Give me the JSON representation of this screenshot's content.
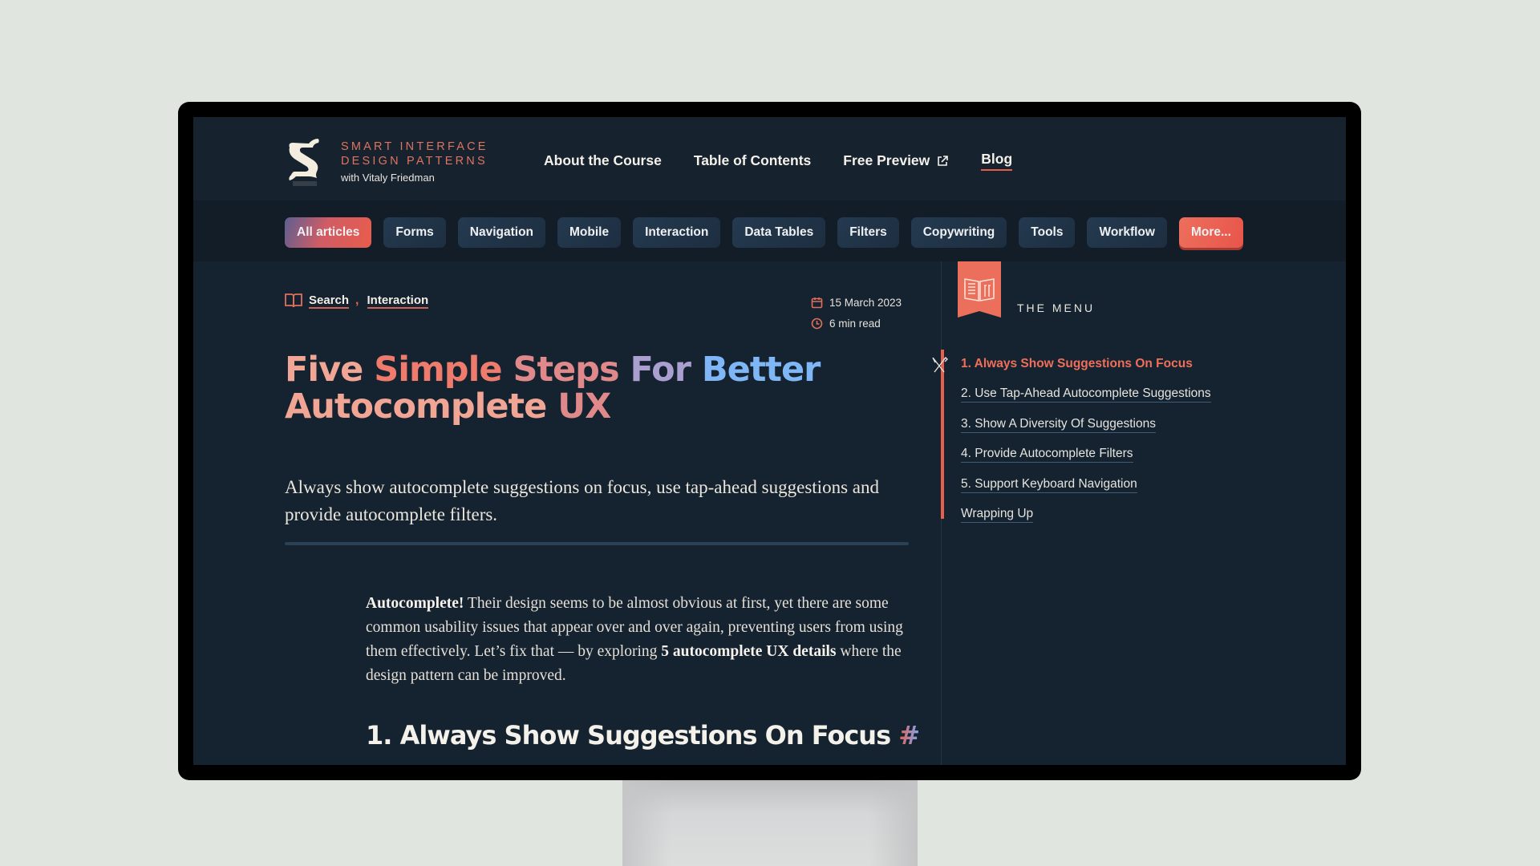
{
  "site": {
    "logo_line1": "SMART INTERFACE",
    "logo_line2": "DESIGN PATTERNS",
    "logo_sub": "with Vitaly Friedman",
    "logo_icon": "s-monogram-icon"
  },
  "nav": {
    "items": [
      {
        "label": "About the Course",
        "active": false
      },
      {
        "label": "Table of Contents",
        "active": false
      },
      {
        "label": "Free Preview",
        "active": false,
        "icon": "external-link-icon"
      },
      {
        "label": "Blog",
        "active": true
      }
    ]
  },
  "filters": {
    "items": [
      {
        "label": "All articles",
        "active": true
      },
      {
        "label": "Forms"
      },
      {
        "label": "Navigation"
      },
      {
        "label": "Mobile"
      },
      {
        "label": "Interaction"
      },
      {
        "label": "Data Tables"
      },
      {
        "label": "Filters"
      },
      {
        "label": "Copywriting"
      },
      {
        "label": "Tools"
      },
      {
        "label": "Workflow"
      },
      {
        "label": "More..."
      }
    ]
  },
  "article": {
    "categories": [
      "Search",
      "Interaction"
    ],
    "category_separator": ",",
    "date": "15 March 2023",
    "read_time": "6 min read",
    "title_words": [
      "Five",
      "Simple",
      "Steps",
      "For",
      "Better",
      "Autocomplete",
      "UX"
    ],
    "lede": "Always show autocomplete suggestions on focus, use tap-ahead suggestions and provide autocomplete filters.",
    "intro_bold_1": "Autocomplete!",
    "intro_text_1": " Their design seems to be almost obvious at first, yet there are some common usability issues that appear over and over again, preventing users from using them effectively. Let’s fix that — by exploring ",
    "intro_bold_2": "5 autocomplete UX details",
    "intro_text_2": " where the design pattern can be improved.",
    "section_heading": "1. Always Show Suggestions On Focus",
    "section_anchor": "#"
  },
  "sidebar": {
    "menu_label": "THE MENU",
    "menu_icon": "menu-book-icon",
    "toc": [
      {
        "label": "1. Always Show Suggestions On Focus",
        "active": true
      },
      {
        "label": "2. Use Tap-Ahead Autocomplete Suggestions"
      },
      {
        "label": "3. Show A Diversity Of Suggestions"
      },
      {
        "label": "4. Provide Autocomplete Filters"
      },
      {
        "label": "5. Support Keyboard Navigation"
      },
      {
        "label": "Wrapping Up"
      }
    ]
  },
  "colors": {
    "accent": "#e8604c",
    "background": "#15222f",
    "title_blue": "#7fb6f5"
  }
}
